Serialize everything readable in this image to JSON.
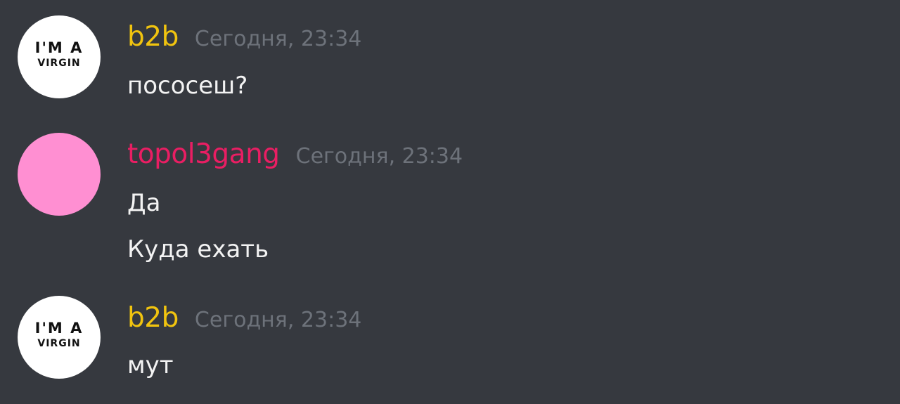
{
  "messages": [
    {
      "author": "b2b",
      "author_color": "#f1c40f",
      "timestamp": "Сегодня, 23:34",
      "avatar": {
        "type": "image",
        "line1": "I'M A",
        "line2": "VIRGIN"
      },
      "lines": [
        "пососеш?"
      ]
    },
    {
      "author": "topol3gang",
      "author_color": "#e91e63",
      "timestamp": "Сегодня, 23:34",
      "avatar": {
        "type": "color",
        "color": "#ff8fd2"
      },
      "lines": [
        "Да",
        "Куда ехать"
      ]
    },
    {
      "author": "b2b",
      "author_color": "#f1c40f",
      "timestamp": "Сегодня, 23:34",
      "avatar": {
        "type": "image",
        "line1": "I'M A",
        "line2": "VIRGIN"
      },
      "lines": [
        "мут"
      ]
    }
  ]
}
